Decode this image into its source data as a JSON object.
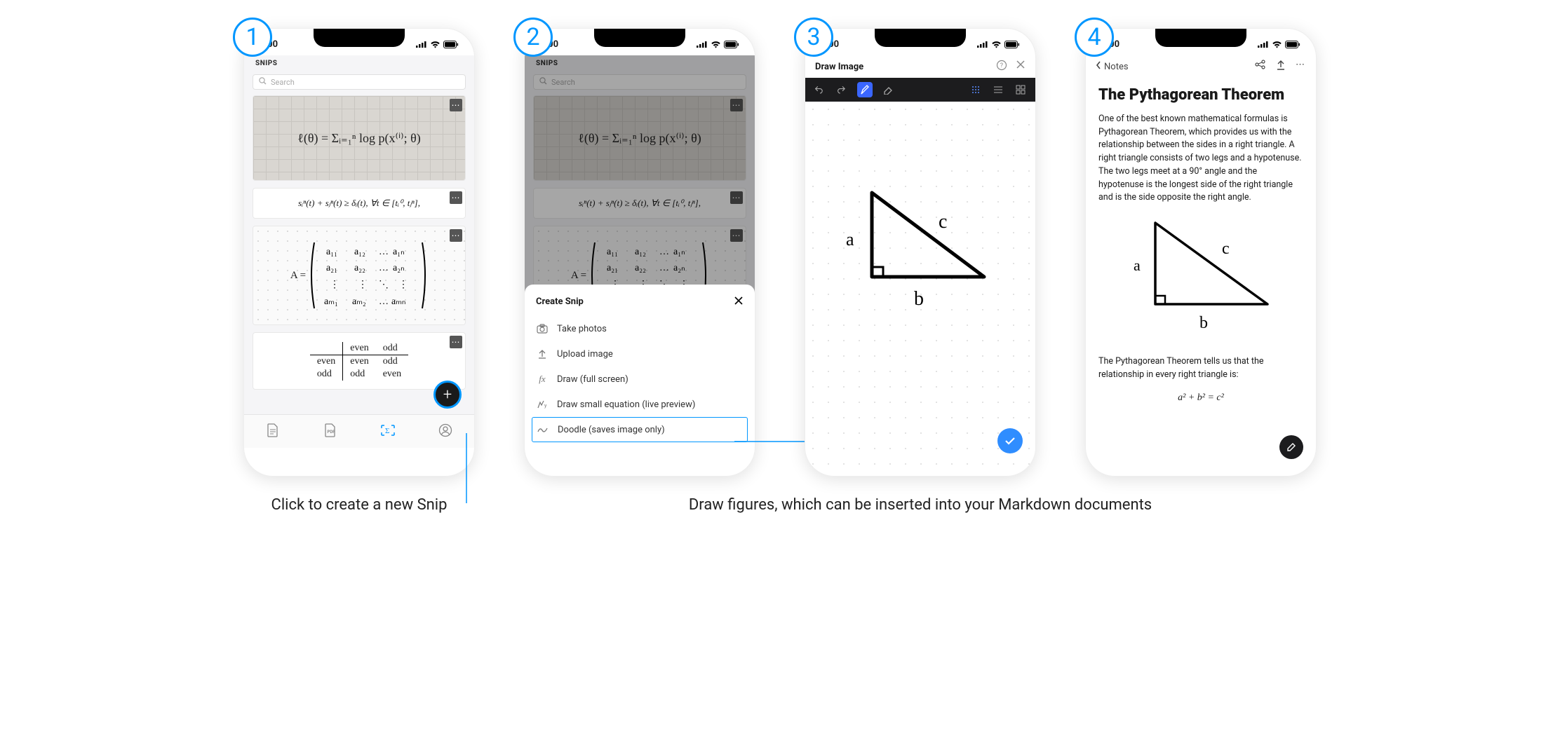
{
  "accent": "#0096FF",
  "statusbar": {
    "time": "9:00"
  },
  "badges": {
    "one": "1",
    "two": "2",
    "three": "3",
    "four": "4"
  },
  "screen1": {
    "header_title": "SNIPS",
    "search_placeholder": "Search",
    "snip1_formula": "ℓ(θ) = Σᵢ₌₁ⁿ log p(x⁽ⁱ⁾; θ)",
    "snip2_formula": "sᵢⁿ(t) + sⱼⁿ(t) ≥ δᵢ(t),  ∀t ∈ [tᵢ⁰, tⱼⁿ],",
    "snip3_matrix_lead": "A =",
    "snip4_table": {
      "cols": [
        "",
        "even",
        "odd"
      ],
      "rows": [
        [
          "even",
          "even",
          "odd"
        ],
        [
          "odd",
          "odd",
          "even"
        ]
      ]
    },
    "fab_label": "+",
    "tabs": [
      "doc",
      "pdf",
      "sigma",
      "avatar"
    ]
  },
  "caption1": "Click to create a new Snip",
  "screen2": {
    "sheet_title": "Create Snip",
    "items": [
      {
        "icon": "camera",
        "label": "Take photos"
      },
      {
        "icon": "upload",
        "label": "Upload image"
      },
      {
        "icon": "fx",
        "label": "Draw (full screen)"
      },
      {
        "icon": "eq",
        "label": "Draw small equation (live preview)"
      },
      {
        "icon": "scribble",
        "label": "Doodle (saves image only)"
      }
    ]
  },
  "screen3": {
    "title": "Draw Image",
    "labels": {
      "a": "a",
      "b": "b",
      "c": "c"
    }
  },
  "caption3": "Draw figures, which can be inserted into your Markdown documents",
  "screen4": {
    "back_label": "Notes",
    "title": "The Pythagorean Theorem",
    "para1": "One of the best known mathematical formulas is Pythagorean Theorem, which provides us with the relationship between the sides in a right triangle. A right triangle consists of two legs and a hypotenuse. The two legs meet at a 90° angle and the hypotenuse is the longest side of the right triangle and is the side opposite the right angle.",
    "para2": "The Pythagorean Theorem tells us that the relationship in every right triangle is:",
    "formula": "a² + b² = c²",
    "labels": {
      "a": "a",
      "b": "b",
      "c": "c"
    }
  }
}
